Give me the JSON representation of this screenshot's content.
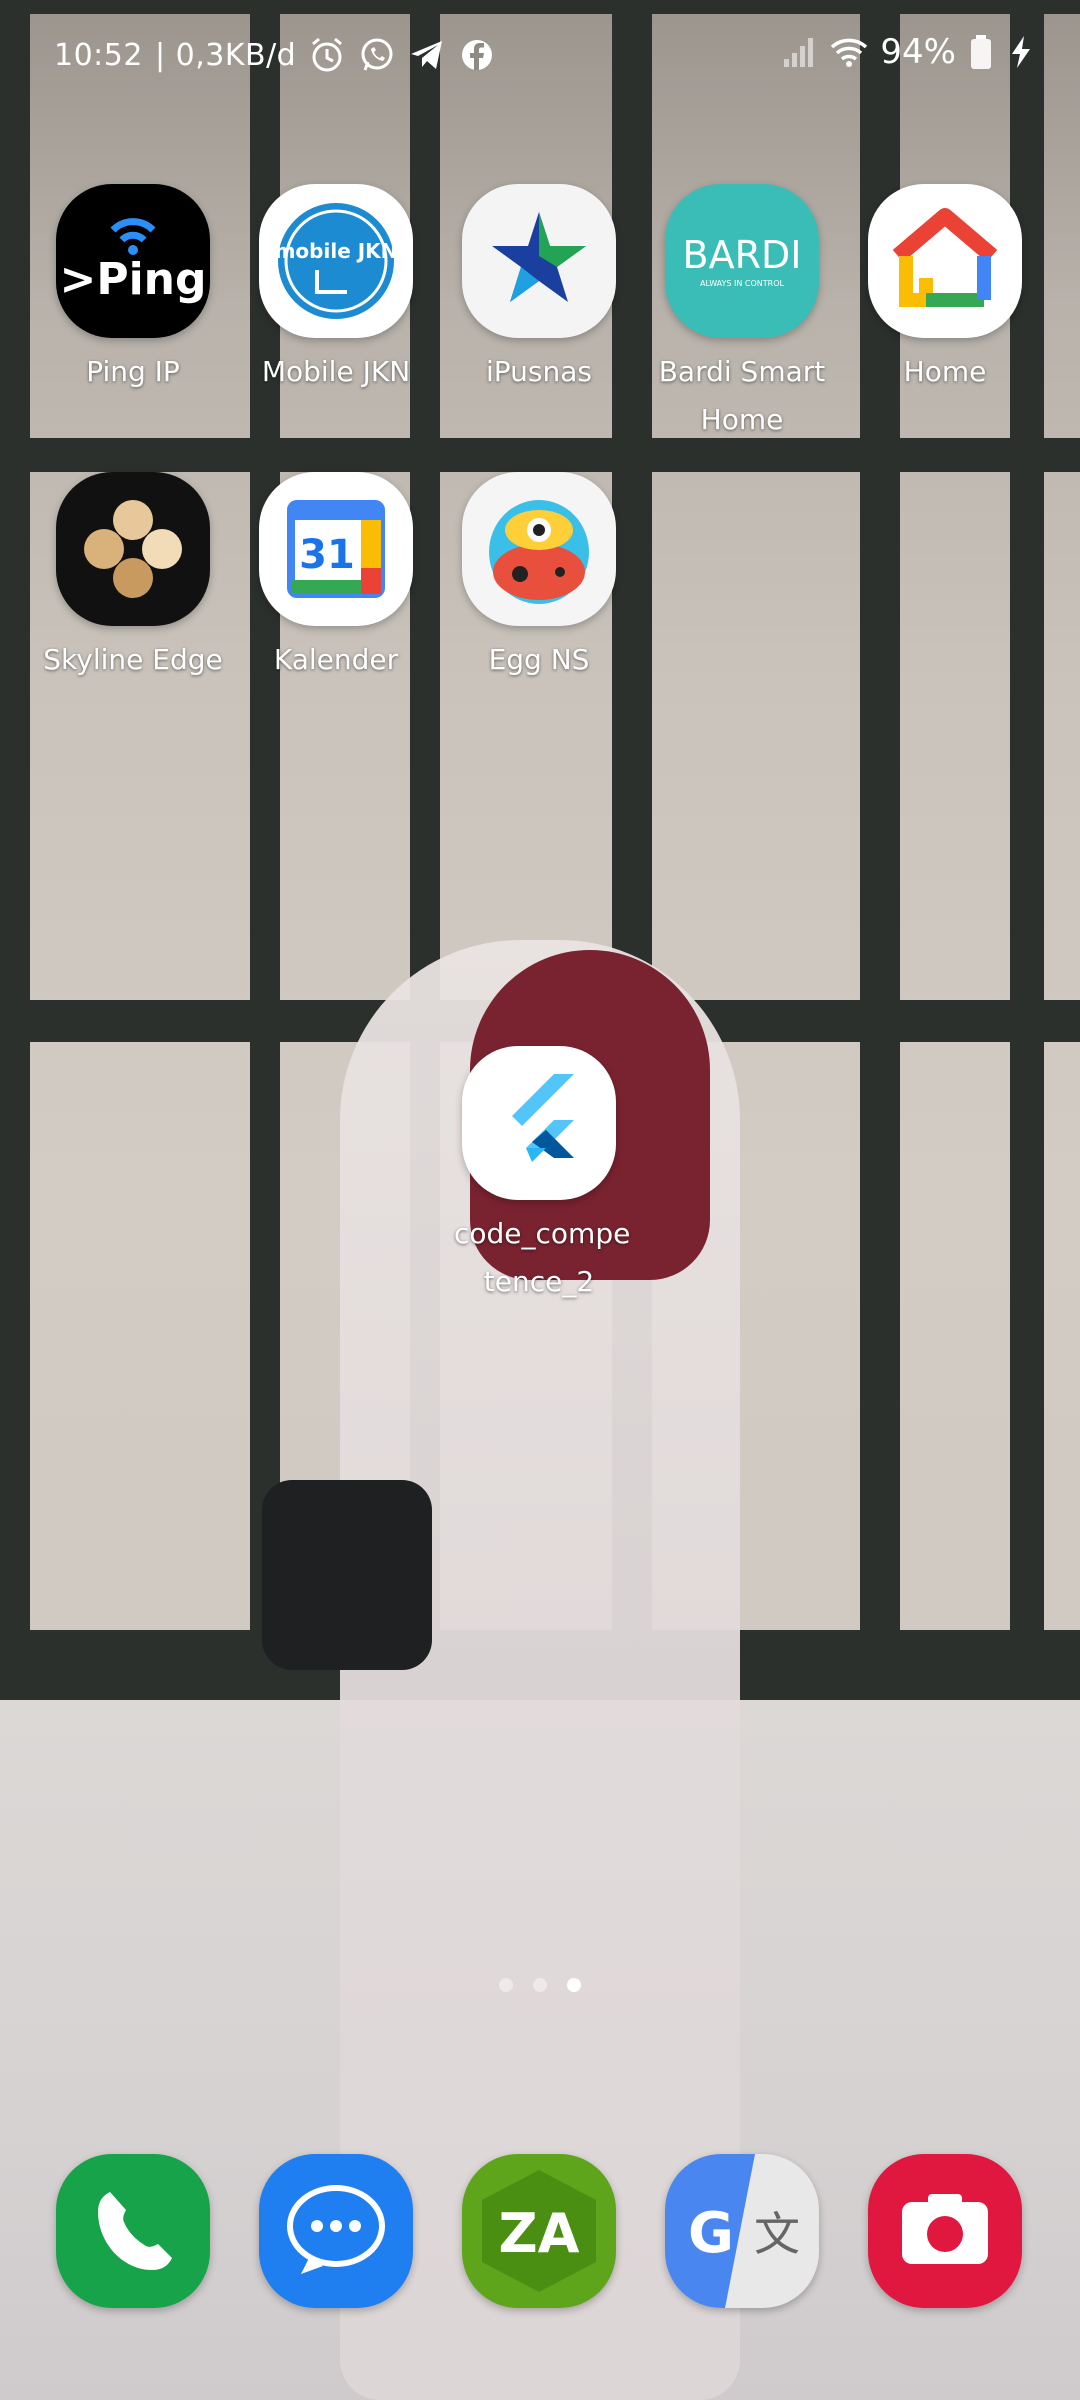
{
  "status_bar": {
    "time": "10:52",
    "net_speed": "| 0,3KB/d",
    "battery_percent": "94%",
    "icons": [
      "alarm-icon",
      "whatsapp-icon",
      "telegram-icon",
      "facebook-icon",
      "signal-icon",
      "wifi-icon",
      "battery-icon",
      "charging-icon"
    ]
  },
  "apps": [
    {
      "label": "Ping IP",
      "icon": "ping-icon",
      "icon_text": ">Ping"
    },
    {
      "label": "Mobile JKN",
      "icon": "mobile-jkn-icon",
      "icon_text": "mobile JKN"
    },
    {
      "label": "iPusnas",
      "icon": "ipusnas-icon"
    },
    {
      "label": "Bardi Smart Home",
      "icon": "bardi-icon",
      "icon_text": "BARDI",
      "icon_subtext": "ALWAYS IN CONTROL"
    },
    {
      "label": "Home",
      "icon": "google-home-icon"
    },
    {
      "label": "Skyline Edge",
      "icon": "skyline-edge-icon"
    },
    {
      "label": "Kalender",
      "icon": "calendar-icon",
      "icon_text": "31"
    },
    {
      "label": "Egg NS",
      "icon": "egg-ns-icon"
    },
    {
      "label": "code_compe tence_2",
      "icon": "flutter-icon"
    }
  ],
  "page_indicator": {
    "count": 3,
    "active_index": 2
  },
  "dock": [
    {
      "name": "phone",
      "icon": "phone-icon"
    },
    {
      "name": "messages",
      "icon": "messages-icon"
    },
    {
      "name": "zarchiver",
      "icon": "zarchiver-icon",
      "icon_text": "ZA"
    },
    {
      "name": "translate",
      "icon": "translate-icon",
      "icon_text": "G",
      "icon_text2": "文"
    },
    {
      "name": "camera",
      "icon": "camera-icon"
    }
  ]
}
